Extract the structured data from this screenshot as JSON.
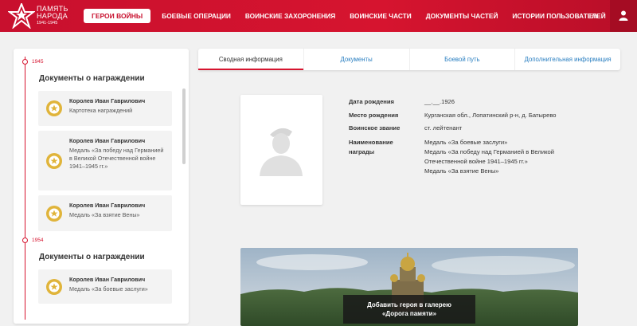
{
  "header": {
    "logo": {
      "line1": "ПАМЯТЬ",
      "line2": "НАРОДА",
      "years": "1941-1945"
    },
    "nav": [
      {
        "label": "ГЕРОИ ВОЙНЫ",
        "active": true
      },
      {
        "label": "БОЕВЫЕ ОПЕРАЦИИ"
      },
      {
        "label": "ВОИНСКИЕ ЗАХОРОНЕНИЯ"
      },
      {
        "label": "ВОИНСКИЕ ЧАСТИ"
      },
      {
        "label": "ДОКУМЕНТЫ ЧАСТЕЙ"
      },
      {
        "label": "ИСТОРИИ ПОЛЬЗОВАТЕЛЕЙ"
      }
    ],
    "lang": "En",
    "colors": {
      "brand": "#c8102e",
      "user_button": "#a50c23"
    }
  },
  "timeline": {
    "groups": [
      {
        "year": "1945",
        "title": "Документы о награждении",
        "cards": [
          {
            "name": "Королев Иван Гаврилович",
            "desc": "Картотека награждений"
          },
          {
            "name": "Королев Иван Гаврилович",
            "desc": "Медаль «За победу над Германией в Великой Отечественной войне 1941–1945 гг.»"
          },
          {
            "name": "Королев Иван Гаврилович",
            "desc": "Медаль «За взятие Вены»"
          }
        ]
      },
      {
        "year": "1954",
        "title": "Документы о награждении",
        "cards": [
          {
            "name": "Королев Иван Гаврилович",
            "desc": "Медаль «За боевые заслуги»"
          }
        ]
      }
    ]
  },
  "tabs": [
    {
      "label": "Сводная информация",
      "active": true
    },
    {
      "label": "Документы"
    },
    {
      "label": "Боевой путь"
    },
    {
      "label": "Дополнительная информация"
    }
  ],
  "person": {
    "fields": [
      {
        "label": "Дата рождения",
        "value": "__.__.1926"
      },
      {
        "label": "Место рождения",
        "value": "Курганская обл., Лопатинский р-н, д. Батырево"
      },
      {
        "label": "Воинское звание",
        "value": "ст. лейтенант"
      },
      {
        "label": "Наименование награды",
        "value_lines": [
          "Медаль «За боевые заслуги»",
          "Медаль «За победу над Германией в Великой",
          "Отечественной войне 1941–1945 гг.»",
          "Медаль «За взятие Вены»"
        ]
      }
    ]
  },
  "banner": {
    "button_line1": "Добавить героя в галерею",
    "button_line2": "«Дорога памяти»"
  }
}
